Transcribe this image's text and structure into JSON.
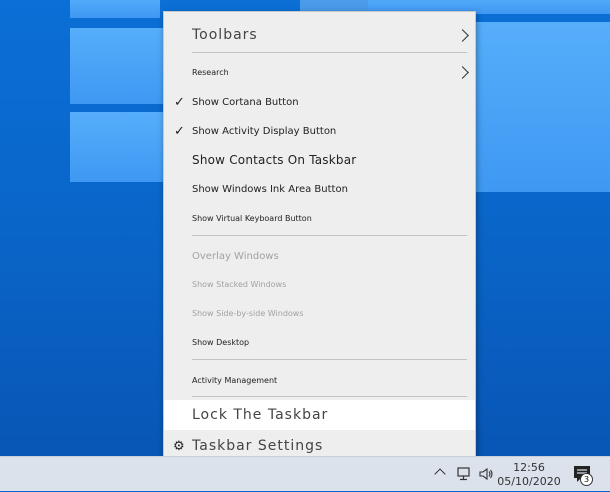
{
  "menu": {
    "toolbars": "Toolbars",
    "research": "Research",
    "show_cortana": "Show Cortana Button",
    "show_activity": "Show Activity Display Button",
    "show_contacts": "Show Contacts On Taskbar",
    "show_ink": "Show Windows Ink Area Button",
    "show_keyboard": "Show Virtual Keyboard Button",
    "overlay_windows": "Overlay Windows",
    "stacked_windows": "Show Stacked Windows",
    "side_by_side": "Show Side-by-side Windows",
    "show_desktop": "Show Desktop",
    "activity_management": "Activity Management",
    "lock_taskbar": "Lock The Taskbar",
    "taskbar_settings": "Taskbar Settings"
  },
  "tray": {
    "time": "12:56",
    "date": "05/10/2020",
    "notification_count": "3"
  },
  "icons": {
    "check": "checkmark-icon",
    "submenu": "chevron-right-icon",
    "settings": "gear-icon",
    "network": "network-icon",
    "volume": "speaker-icon",
    "notifications": "action-center-icon",
    "hidden_icons": "chevron-up-icon"
  },
  "colors": {
    "desktop": "#0a63c8",
    "menu_bg": "#eeeeee",
    "highlight": "#ffffff",
    "taskbar": "#dbe2ec"
  }
}
